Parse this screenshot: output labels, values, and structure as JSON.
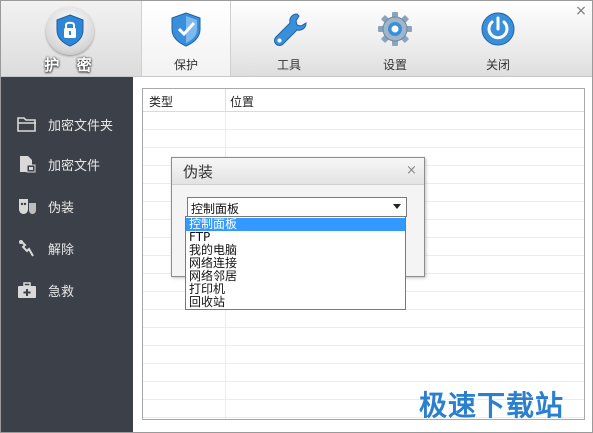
{
  "app": {
    "logo_text": "护 密",
    "close_symbol": "×"
  },
  "nav": [
    {
      "label": "保护",
      "icon": "shield-icon",
      "active": true
    },
    {
      "label": "工具",
      "icon": "wrench-icon",
      "active": false
    },
    {
      "label": "设置",
      "icon": "gear-icon",
      "active": false
    },
    {
      "label": "关闭",
      "icon": "power-icon",
      "active": false
    }
  ],
  "sidebar": {
    "items": [
      {
        "label": "加密文件夹",
        "icon": "folder-icon"
      },
      {
        "label": "加密文件",
        "icon": "file-icon"
      },
      {
        "label": "伪装",
        "icon": "disguise-icon"
      },
      {
        "label": "解除",
        "icon": "unlock-icon"
      },
      {
        "label": "急救",
        "icon": "first-aid-icon"
      }
    ]
  },
  "table": {
    "columns": [
      "类型",
      "位置"
    ]
  },
  "dialog": {
    "title": "伪装",
    "close_symbol": "×",
    "selected": "控制面板",
    "options": [
      "控制面板",
      "FTP",
      "我的电脑",
      "网络连接",
      "网络邻居",
      "打印机",
      "回收站"
    ]
  },
  "watermark": "极速下载站",
  "colors": {
    "sidebar_bg": "#3c4048",
    "accent_blue": "#3399ff",
    "icon_blue": "#2f86d6"
  }
}
